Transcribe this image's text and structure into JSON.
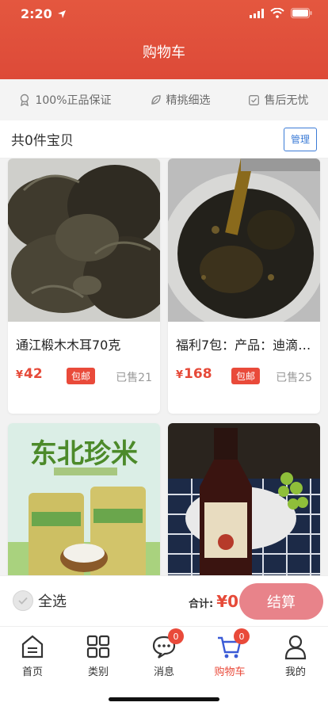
{
  "status_bar": {
    "time": "2:20"
  },
  "header": {
    "title": "购物车"
  },
  "guarantees": [
    {
      "icon": "medal-icon",
      "label": "100%正品保证"
    },
    {
      "icon": "leaf-icon",
      "label": "精挑细选"
    },
    {
      "icon": "check-square-icon",
      "label": "售后无忧"
    }
  ],
  "cart": {
    "count_text": "共0件宝贝",
    "manage_label": "管理"
  },
  "products": [
    {
      "name": "通江椴木木耳70克",
      "price_symbol": "¥",
      "price": "42",
      "badge": "包邮",
      "sold": "已售21"
    },
    {
      "name": "福利7包：产品：迪滴香…",
      "price_symbol": "¥",
      "price": "168",
      "badge": "包邮",
      "sold": "已售25"
    },
    {
      "name": "",
      "image_text": "东北珍米",
      "price_symbol": "",
      "price": "",
      "badge": "",
      "sold": ""
    },
    {
      "name": "",
      "price_symbol": "",
      "price": "",
      "badge": "",
      "sold": ""
    }
  ],
  "action_bar": {
    "select_all_label": "全选",
    "total_label": "合计:",
    "total_value": "¥0",
    "checkout_label": "结算"
  },
  "tabbar": {
    "items": [
      {
        "label": "首页",
        "icon": "home-icon",
        "badge": ""
      },
      {
        "label": "类别",
        "icon": "category-icon",
        "badge": ""
      },
      {
        "label": "消息",
        "icon": "message-icon",
        "badge": "0"
      },
      {
        "label": "购物车",
        "icon": "cart-icon",
        "badge": "0"
      },
      {
        "label": "我的",
        "icon": "profile-icon",
        "badge": ""
      }
    ],
    "active": "购物车"
  },
  "colors": {
    "brand_red": "#e4573f",
    "price_red": "#e64a39",
    "manage_blue": "#3b7bd6",
    "checkout_pink": "#e8838a"
  }
}
